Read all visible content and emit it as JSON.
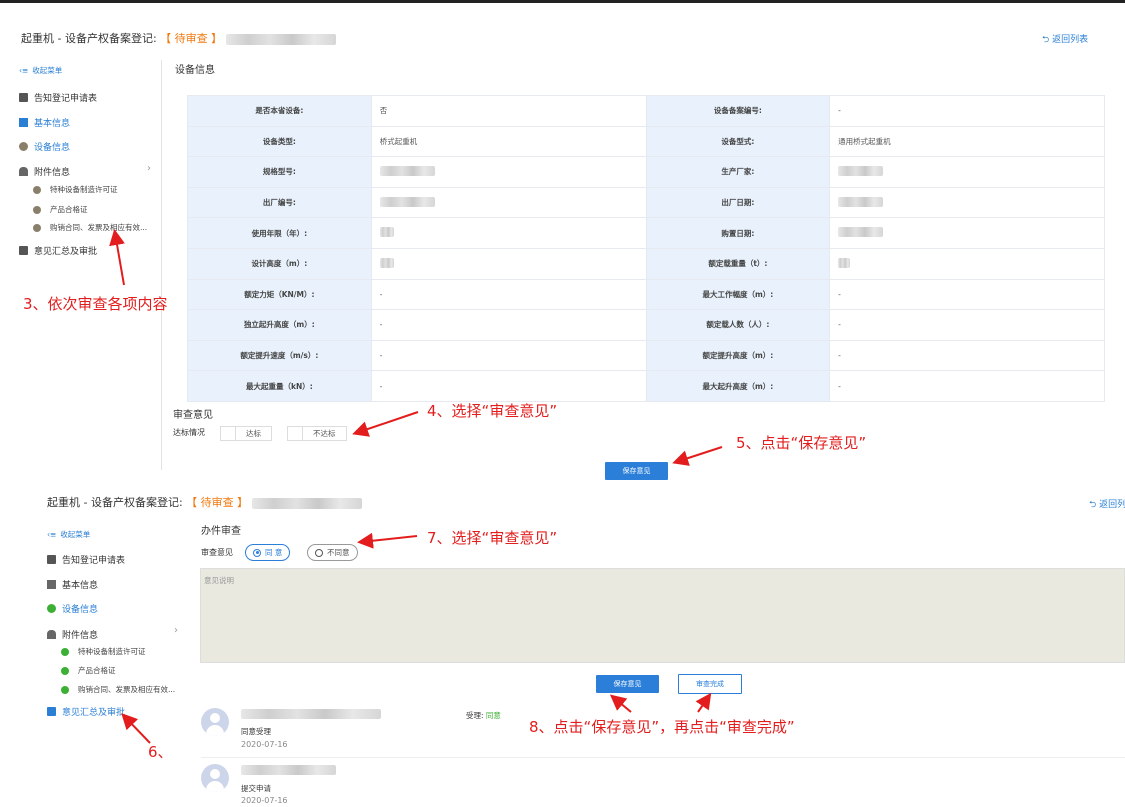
{
  "upper": {
    "title_prefix": "起重机 - 设备产权备案登记:",
    "status": "【 待审查 】",
    "back_label": "返回列表",
    "sidebar": {
      "collapse_label": "收起菜单",
      "items": [
        {
          "label": "告知登记申请表"
        },
        {
          "label": "基本信息"
        },
        {
          "label": "设备信息"
        },
        {
          "label": "附件信息"
        },
        {
          "label": "特种设备制造许可证"
        },
        {
          "label": "产品合格证"
        },
        {
          "label": "购销合同、发票及相应有效..."
        },
        {
          "label": "意见汇总及审批"
        }
      ]
    },
    "section_title": "设备信息",
    "table": [
      [
        "是否本省设备:",
        "否",
        "设备备案编号:",
        "-"
      ],
      [
        "设备类型:",
        "桥式起重机",
        "设备型式:",
        "通用桥式起重机"
      ],
      [
        "规格型号:",
        "",
        "生产厂家:",
        ""
      ],
      [
        "出厂编号:",
        "",
        "出厂日期:",
        ""
      ],
      [
        "使用年限（年）:",
        "",
        "购置日期:",
        ""
      ],
      [
        "设计高度（m）:",
        "",
        "额定载重量（t）:",
        ""
      ],
      [
        "额定力矩（KN/M）:",
        "-",
        "最大工作幅度（m）:",
        "-"
      ],
      [
        "独立起升高度（m）:",
        "-",
        "额定载人数（人）:",
        "-"
      ],
      [
        "额定提升速度（m/s）:",
        "-",
        "额定提升高度（m）:",
        "-"
      ],
      [
        "最大起重量（kN）:",
        "-",
        "最大起升高度（m）:",
        "-"
      ]
    ],
    "review_title": "审查意见",
    "compliance_label": "达标情况",
    "option_pass": "达标",
    "option_fail": "不达标",
    "save_label": "保存意见"
  },
  "lower": {
    "title_prefix": "起重机 - 设备产权备案登记:",
    "status": "【 待审查 】",
    "back_label": "返回列",
    "sidebar": {
      "collapse_label": "收起菜单",
      "items": [
        {
          "label": "告知登记申请表"
        },
        {
          "label": "基本信息"
        },
        {
          "label": "设备信息"
        },
        {
          "label": "附件信息"
        },
        {
          "label": "特种设备制造许可证"
        },
        {
          "label": "产品合格证"
        },
        {
          "label": "购销合同、发票及相应有效..."
        },
        {
          "label": "意见汇总及审批"
        }
      ]
    },
    "section_title": "办件审查",
    "opinion_label": "审查意见",
    "option_agree": "同 意",
    "option_disagree": "不同意",
    "textarea_placeholder": "意见说明",
    "save_label": "保存意见",
    "complete_label": "审查完成",
    "records": [
      {
        "text": "同意受理",
        "date": "2020-07-16",
        "action_label": "受理:",
        "action_value": "同意"
      },
      {
        "text": "提交申请",
        "date": "2020-07-16"
      }
    ]
  },
  "annotations": [
    "3、依次审查各项内容",
    "4、选择“审查意见”",
    "5、点击“保存意见”",
    "6、",
    "7、选择“审查意见”",
    "8、点击“保存意见”，再点击“审查完成”"
  ],
  "colors": {
    "accent": "#2b7fd9",
    "status": "#f07a10",
    "annotation": "#e31d1d",
    "success": "#3cb034"
  }
}
